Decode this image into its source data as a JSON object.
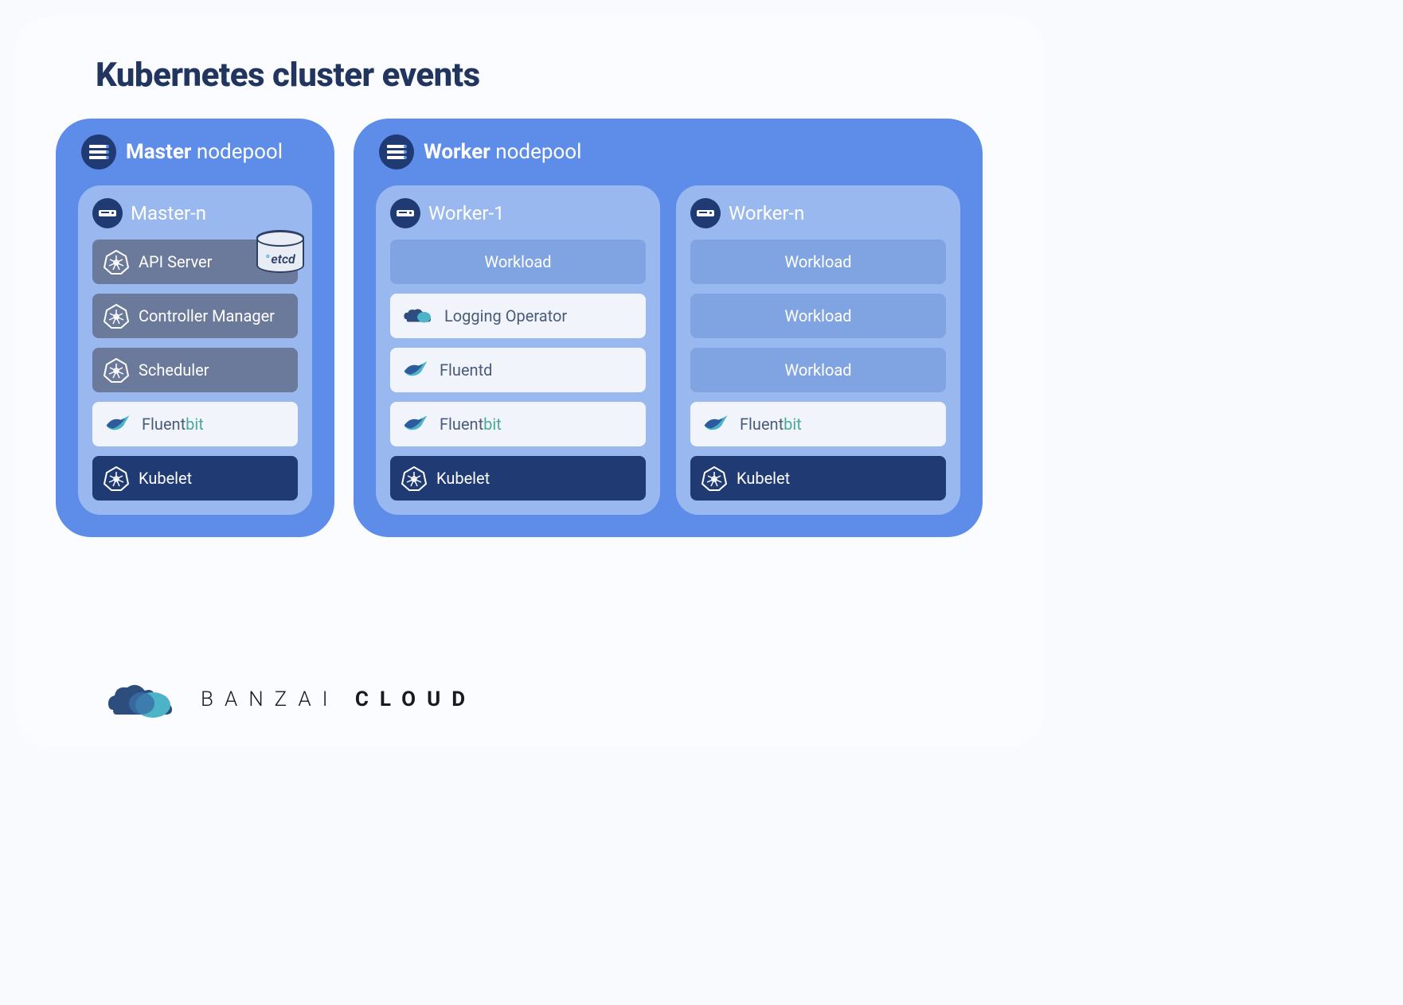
{
  "title": "Kubernetes cluster events",
  "pools": {
    "master": {
      "label_bold": "Master",
      "label_rest": " nodepool"
    },
    "worker": {
      "label_bold": "Worker",
      "label_rest": " nodepool"
    }
  },
  "nodes": {
    "master_n": {
      "title": "Master-n",
      "items": {
        "api_server": "API Server",
        "etcd": "etcd",
        "controller_manager": "Controller Manager",
        "scheduler": "Scheduler",
        "fluentbit_a": "Fluent",
        "fluentbit_b": "bit",
        "kubelet": "Kubelet"
      }
    },
    "worker_1": {
      "title": "Worker-1",
      "items": {
        "workload": "Workload",
        "logging_operator": "Logging Operator",
        "fluentd": "Fluentd",
        "fluentbit_a": "Fluent",
        "fluentbit_b": "bit",
        "kubelet": "Kubelet"
      }
    },
    "worker_n": {
      "title": "Worker-n",
      "items": {
        "workload1": "Workload",
        "workload2": "Workload",
        "workload3": "Workload",
        "fluentbit_a": "Fluent",
        "fluentbit_b": "bit",
        "kubelet": "Kubelet"
      }
    }
  },
  "footer": {
    "a": "BANZAI ",
    "b": "CLOUD"
  }
}
